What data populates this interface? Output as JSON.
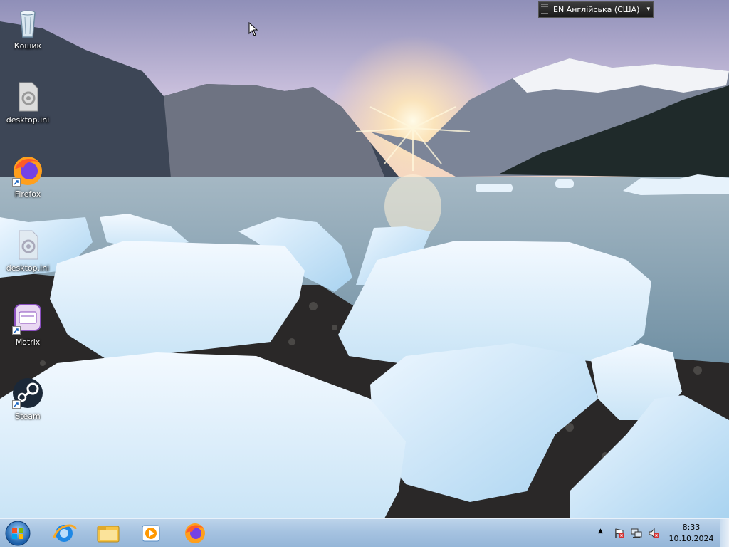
{
  "desktop": {
    "icons": [
      {
        "label": "Кошик",
        "icon": "recycle-bin-icon"
      },
      {
        "label": "desktop.ini",
        "icon": "settings-file-icon"
      },
      {
        "label": "Firefox",
        "icon": "firefox-icon"
      },
      {
        "label": "desktop.ini",
        "icon": "settings-file-icon"
      },
      {
        "label": "Motrix",
        "icon": "motrix-icon"
      },
      {
        "label": "Steam",
        "icon": "steam-icon"
      }
    ]
  },
  "language_bar": {
    "text": "EN Англійська (США)"
  },
  "taskbar": {
    "pinned": [
      "internet-explorer-icon",
      "file-explorer-icon",
      "media-player-icon",
      "firefox-icon"
    ],
    "clock": {
      "time": "8:33",
      "date": "10.10.2024"
    }
  },
  "colors": {
    "taskbar": "#a6c3e1",
    "sky": "#c7bfd9",
    "water": "#8aa9b8"
  }
}
